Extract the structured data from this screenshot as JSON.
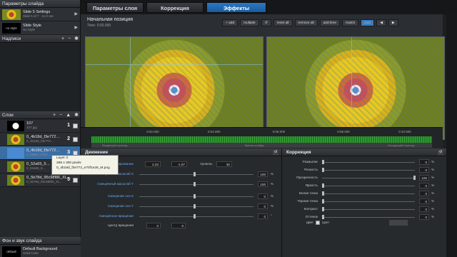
{
  "left": {
    "slide_params_title": "Параметры слайда",
    "slide1": {
      "title": "Slide 5 Settings",
      "sub": "Slide 5 of 7 · 11.0 sec"
    },
    "slide2": {
      "thumb": "no style",
      "title": "Slide Style",
      "sub": "No Style"
    },
    "captions_title": "Надписи",
    "layers_title": "Слои",
    "layers": [
      {
        "name": "107",
        "sub": "107.jpg",
        "num": "1"
      },
      {
        "name": "0_4b18d_f3e772…",
        "sub": "0_4b18d_f3e772…",
        "num": "2"
      },
      {
        "name": "0_4b18d_f3e772…",
        "sub": "0_3d5e7_e70f…",
        "num": "3"
      },
      {
        "name": "0_52a65_5…",
        "sub": "0_52a65_5…",
        "num": "4"
      },
      {
        "name": "0_5b78d_95c98f86_XL…",
        "sub": "0_5b78d_95c98f86_XL…",
        "num": "5"
      }
    ],
    "tooltip": {
      "l1": "Layer 3",
      "l2": "286 x 300 pixels",
      "l3": "0_4b18d_f3e772_e70f1e28_M.png"
    },
    "bg_title": "Фон и звук слайда",
    "bg_item": {
      "label": "default",
      "title": "Default Background",
      "sub": "Solid Color"
    }
  },
  "tabs": [
    "Параметры слоя",
    "Коррекция",
    "Эффекты"
  ],
  "preview": {
    "title": "Начальная позиция",
    "time": "Time: 0:00.000",
    "buttons": [
      "+ add",
      "multiple",
      "reset all",
      "remove all",
      "add time",
      "match"
    ]
  },
  "timeline": {
    "ticks": [
      "0:02.000",
      "0:04.000",
      "0:06.000",
      "0:08.000",
      "0:10.000"
    ],
    "labels": [
      "Входящий переход",
      "Время слайда",
      "Исходящий переход"
    ]
  },
  "motion": {
    "title": "Движение",
    "rows": [
      {
        "label": "Панорамирование",
        "v1": "2.23",
        "v2": "-1.07",
        "extra": "Уровень",
        "v3": "30"
      },
      {
        "label": "Смещённый масштаб X",
        "val": "100"
      },
      {
        "label": "Смещённый масштаб Y",
        "val": "100"
      },
      {
        "label": "Смещение оси X",
        "val": "0"
      },
      {
        "label": "Смещение оси Y",
        "val": "0"
      },
      {
        "label": "Смещённое вращение",
        "val": "0"
      },
      {
        "label": "Центр вращения",
        "v1": "0",
        "v2": "0"
      }
    ]
  },
  "correction": {
    "title": "Коррекция",
    "rows": [
      {
        "label": "Размытие",
        "val": "0"
      },
      {
        "label": "Резкость",
        "val": "0"
      },
      {
        "label": "Прозрачность",
        "val": "100"
      },
      {
        "label": "Яркость",
        "val": "0"
      },
      {
        "label": "Белая точка",
        "val": "0"
      },
      {
        "label": "Черная точка",
        "val": "0"
      },
      {
        "label": "Контраст",
        "val": "0"
      },
      {
        "label": "Оттенок",
        "val": "0"
      }
    ],
    "color_label": "Цвет",
    "color_label2": "Цвет"
  }
}
